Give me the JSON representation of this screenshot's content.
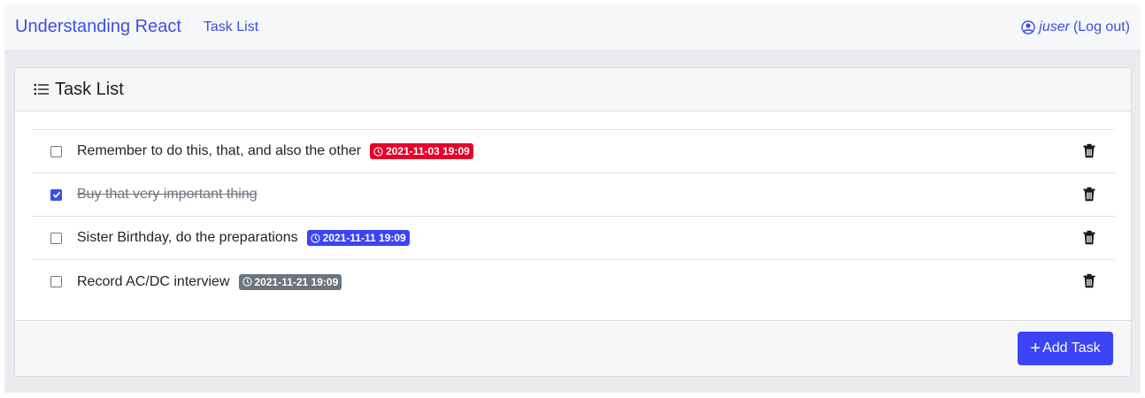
{
  "navbar": {
    "brand": "Understanding React",
    "link_task_list": "Task List",
    "user": "juser",
    "logout": "(Log out)"
  },
  "card": {
    "title": "Task List"
  },
  "tasks": [
    {
      "text": "Remember to do this, that, and also the other",
      "done": false,
      "due": "2021-11-03 19:09",
      "due_color": "#e4002b"
    },
    {
      "text": "Buy that very important thing",
      "done": true,
      "due": "",
      "due_color": ""
    },
    {
      "text": "Sister Birthday, do the preparations",
      "done": false,
      "due": "2021-11-11 19:09",
      "due_color": "#3b45f5"
    },
    {
      "text": "Record AC/DC interview",
      "done": false,
      "due": "2021-11-21 19:09",
      "due_color": "#6c757d"
    }
  ],
  "footer": {
    "add_task_label": "Add Task"
  },
  "colors": {
    "accent": "#3b4fe4",
    "button": "#3b45f5",
    "overdue": "#e4002b",
    "upcoming": "#3b45f5",
    "later": "#6c757d"
  },
  "icons": {
    "user": "person-circle-icon",
    "list": "list-icon",
    "clock": "clock-icon",
    "delete": "trash-icon",
    "add": "plus-icon"
  }
}
